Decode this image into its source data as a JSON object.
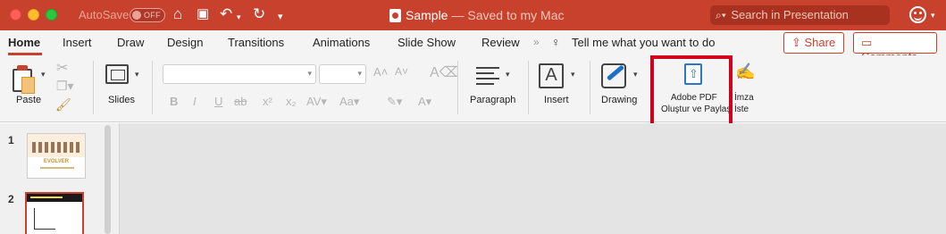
{
  "titlebar": {
    "autosave_label": "AutoSave",
    "autosave_state": "OFF",
    "doc_name": "Sample",
    "doc_status": "— Saved to my Mac",
    "search_placeholder": "Search in Presentation",
    "colors": {
      "bar": "#c8412c",
      "accent": "#c8412c"
    }
  },
  "tabs": {
    "items": [
      "Home",
      "Insert",
      "Draw",
      "Design",
      "Transitions",
      "Animations",
      "Slide Show",
      "Review"
    ],
    "active": "Home",
    "tell_me": "Tell me what you want to do",
    "share_label": "Share",
    "comments_label": "Comments"
  },
  "ribbon": {
    "paste_label": "Paste",
    "slides_label": "Slides",
    "font_name_value": "",
    "font_size_value": "",
    "format_buttons": [
      "B",
      "I",
      "U",
      "ab",
      "x²",
      "x₂"
    ],
    "paragraph_label": "Paragraph",
    "insert_label": "Insert",
    "drawing_label": "Drawing",
    "adobe_pdf_line1": "Adobe PDF",
    "adobe_pdf_line2": "Oluştur ve Paylaş",
    "imza_line1": "İmza",
    "imza_line2": "İste",
    "highlight_color": "#d0021b"
  },
  "thumbnails": {
    "slides": [
      {
        "number": "1",
        "title": "EVOLVER"
      },
      {
        "number": "2",
        "title": ""
      }
    ],
    "selected": "2"
  }
}
